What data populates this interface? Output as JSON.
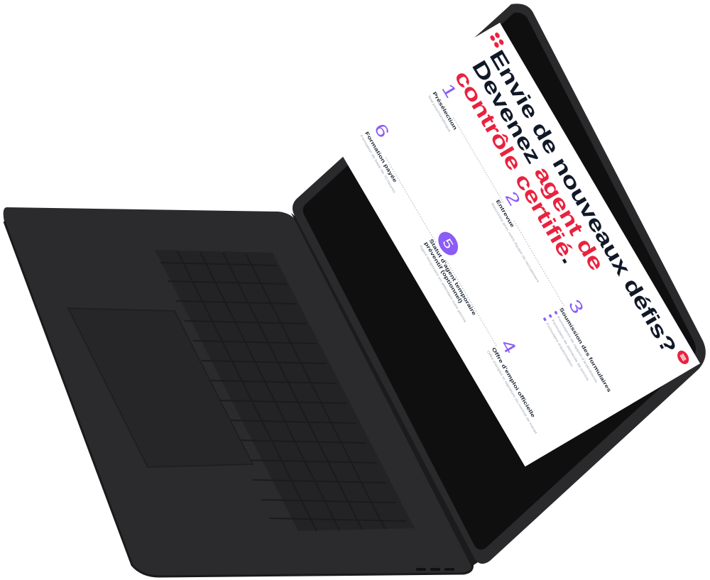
{
  "theme": {
    "accent": "#e8233f",
    "purple": "#8b5cf6"
  },
  "headline": {
    "line1": "Envie de nouveaux défis?",
    "line2_prefix": "Devenez ",
    "line2_accent": "agent de contrôle certifié",
    "line2_suffix": "."
  },
  "header": {
    "logo_icon": "three-dots-logo",
    "menu_icon": "hamburger-menu-icon"
  },
  "steps": [
    {
      "number": "1",
      "title": "Présélection",
      "desc": "Test psychométrique"
    },
    {
      "number": "2",
      "title": "Entrevue",
      "desc": "Rencontre avec notre équipe de recrutement"
    },
    {
      "number": "3",
      "title": "Soumission des formulaires",
      "items": [
        "Formulaires de rapport d'antécédents",
        "Formulaire de demande de permis",
        "Formulaire d'autorisation"
      ]
    },
    {
      "number": "4",
      "title": "Offre d'emploi officielle",
      "desc": "Offre d'emploi et signature du contrat de travail"
    },
    {
      "number": "5",
      "title": "Statut d'agent temporaire préventif (optionnel)",
      "desc": "Agent temporaire en attendant votre permis"
    },
    {
      "number": "6",
      "title": "Formation payée",
      "desc": "Formation de base de 70 heures"
    }
  ]
}
